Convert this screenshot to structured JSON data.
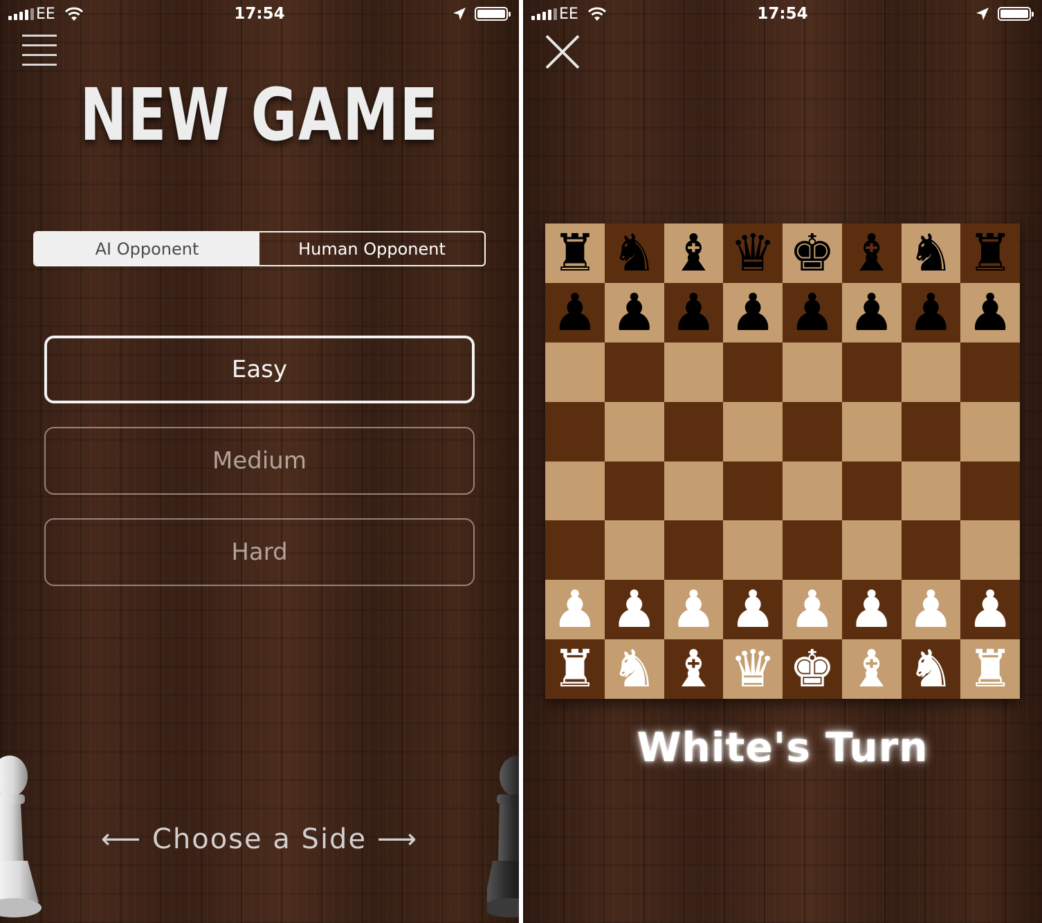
{
  "status_bar": {
    "carrier": "EE",
    "time": "17:54"
  },
  "left_screen": {
    "title": "NEW GAME",
    "opponent_tabs": [
      {
        "label": "AI Opponent",
        "selected": true
      },
      {
        "label": "Human Opponent",
        "selected": false
      }
    ],
    "difficulties": [
      {
        "label": "Easy",
        "selected": true
      },
      {
        "label": "Medium",
        "selected": false
      },
      {
        "label": "Hard",
        "selected": false
      }
    ],
    "choose_side": {
      "left_arrow": "⟵",
      "label": "Choose a Side",
      "right_arrow": "⟶"
    }
  },
  "right_screen": {
    "turn_label": "White's Turn",
    "board": {
      "light_color": "#c49e71",
      "dark_color": "#5c2e10",
      "rows": [
        [
          "bR",
          "bN",
          "bB",
          "bQ",
          "bK",
          "bB",
          "bN",
          "bR"
        ],
        [
          "bP",
          "bP",
          "bP",
          "bP",
          "bP",
          "bP",
          "bP",
          "bP"
        ],
        [
          "",
          "",
          "",
          "",
          "",
          "",
          "",
          ""
        ],
        [
          "",
          "",
          "",
          "",
          "",
          "",
          "",
          ""
        ],
        [
          "",
          "",
          "",
          "",
          "",
          "",
          "",
          ""
        ],
        [
          "",
          "",
          "",
          "",
          "",
          "",
          "",
          ""
        ],
        [
          "wP",
          "wP",
          "wP",
          "wP",
          "wP",
          "wP",
          "wP",
          "wP"
        ],
        [
          "wR",
          "wN",
          "wB",
          "wQ",
          "wK",
          "wB",
          "wN",
          "wR"
        ]
      ]
    }
  },
  "icons": {
    "menu": "hamburger-icon",
    "close": "close-icon",
    "signal": "signal-icon",
    "wifi": "wifi-icon",
    "location": "location-arrow-icon",
    "battery": "battery-icon"
  }
}
